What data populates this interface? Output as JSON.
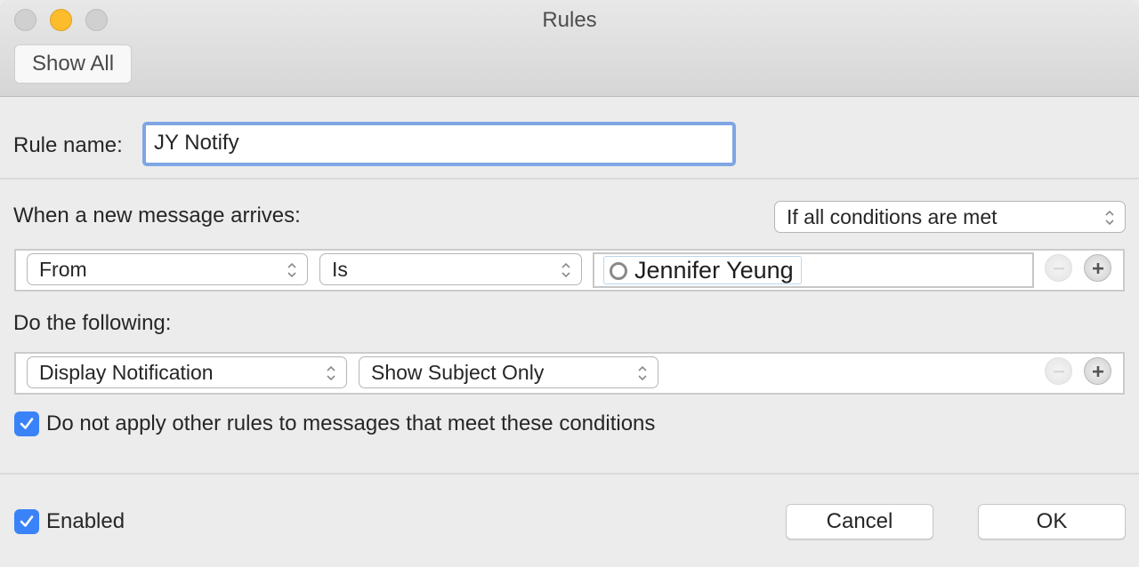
{
  "window": {
    "title": "Rules",
    "controls": {
      "close": "close-button",
      "minimize": "minimize-button",
      "zoom": "zoom-button"
    },
    "minimize_color": "#fdbc2c"
  },
  "toolbar": {
    "show_all_label": "Show All"
  },
  "rule_name": {
    "label": "Rule name:",
    "value": "JY Notify"
  },
  "conditions": {
    "label": "When a new message arrives:",
    "match_mode": "If all conditions are met",
    "rows": [
      {
        "field": "From",
        "operator": "Is",
        "value_token": "Jennifer Yeung"
      }
    ]
  },
  "actions": {
    "label": "Do the following:",
    "rows": [
      {
        "action": "Display Notification",
        "option": "Show Subject Only"
      }
    ]
  },
  "stop_rules": {
    "label": "Do not apply other rules to messages that meet these conditions",
    "checked": true
  },
  "footer": {
    "enabled_label": "Enabled",
    "enabled_checked": true,
    "cancel_label": "Cancel",
    "ok_label": "OK"
  },
  "accent_color": "#3a82f7"
}
